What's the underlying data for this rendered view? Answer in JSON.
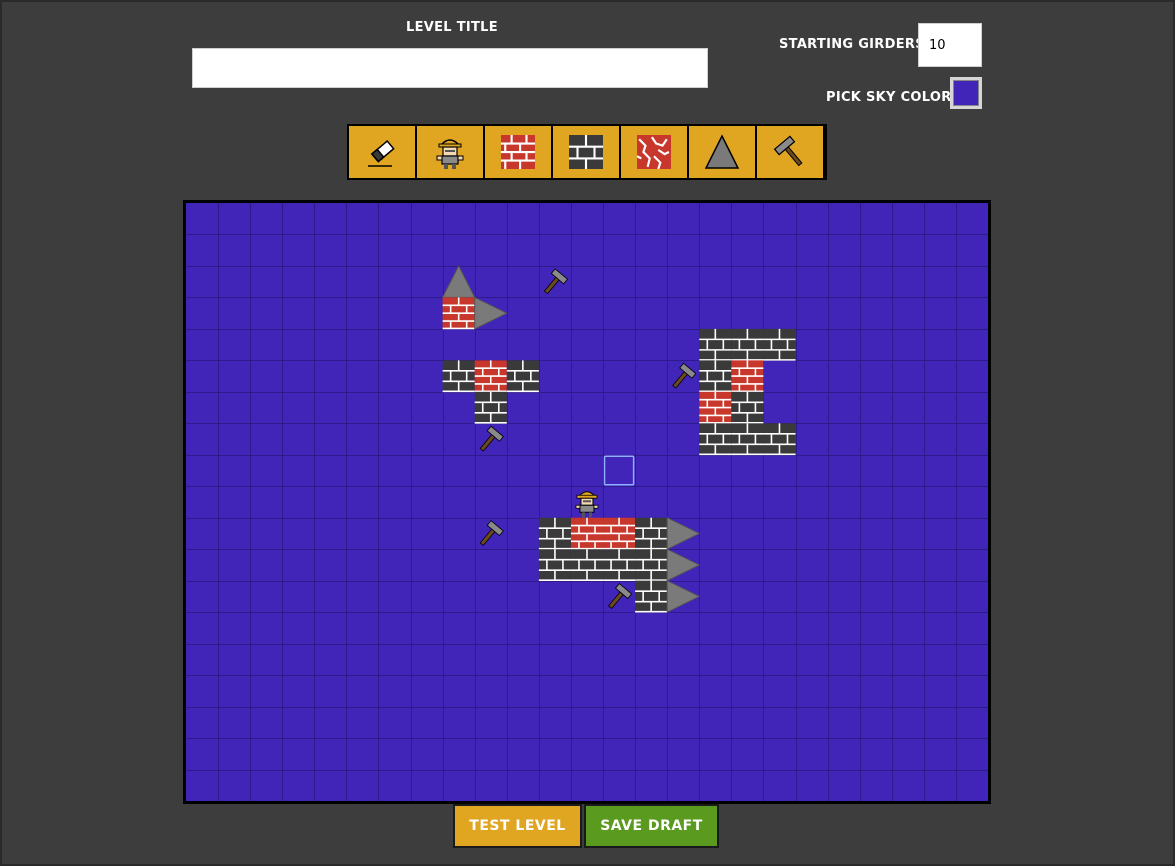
{
  "header": {
    "level_title_label": "LEVEL TITLE",
    "level_title_value": "",
    "starting_girders_label": "STARTING GIRDERS",
    "starting_girders_value": "10",
    "sky_color_label": "PICK SKY COLOR",
    "sky_color": "#4124b8"
  },
  "toolbar": {
    "tools": [
      {
        "name": "eraser-tool",
        "icon": "eraser-icon"
      },
      {
        "name": "worker-tool",
        "icon": "worker-icon"
      },
      {
        "name": "red-brick-tool",
        "icon": "red-brick-icon"
      },
      {
        "name": "dark-brick-tool",
        "icon": "dark-brick-icon"
      },
      {
        "name": "cracked-brick-tool",
        "icon": "cracked-brick-icon"
      },
      {
        "name": "spike-tool",
        "icon": "spike-icon"
      },
      {
        "name": "hammer-tool",
        "icon": "hammer-icon"
      }
    ]
  },
  "board": {
    "columns": 25,
    "rows": 19,
    "colors": {
      "sky": "#4124b8",
      "grid": "#2e1a8a",
      "red_brick": "#c8372c",
      "dark_brick": "#3a3a3a",
      "spike": "#7a7a7a",
      "hammer_head": "#8a8a8a",
      "hammer_handle": "#6b4a1e",
      "cursor": "#8fb0ff"
    },
    "tiles": [
      {
        "type": "spike",
        "col": 8,
        "row": 2,
        "dir": "up"
      },
      {
        "type": "red",
        "col": 8,
        "row": 3
      },
      {
        "type": "spike",
        "col": 9,
        "row": 3,
        "dir": "right"
      },
      {
        "type": "hammer",
        "col": 11,
        "row": 2
      },
      {
        "type": "dark",
        "col": 8,
        "row": 5
      },
      {
        "type": "red",
        "col": 9,
        "row": 5
      },
      {
        "type": "dark",
        "col": 10,
        "row": 5
      },
      {
        "type": "dark",
        "col": 9,
        "row": 6
      },
      {
        "type": "hammer",
        "col": 9,
        "row": 7
      },
      {
        "type": "dark",
        "col": 16,
        "row": 4
      },
      {
        "type": "dark",
        "col": 17,
        "row": 4
      },
      {
        "type": "dark",
        "col": 18,
        "row": 4
      },
      {
        "type": "hammer",
        "col": 15,
        "row": 5
      },
      {
        "type": "dark",
        "col": 16,
        "row": 5
      },
      {
        "type": "red",
        "col": 17,
        "row": 5
      },
      {
        "type": "red",
        "col": 16,
        "row": 6
      },
      {
        "type": "dark",
        "col": 17,
        "row": 6
      },
      {
        "type": "dark",
        "col": 16,
        "row": 7
      },
      {
        "type": "dark",
        "col": 17,
        "row": 7
      },
      {
        "type": "dark",
        "col": 18,
        "row": 7
      },
      {
        "type": "cursor",
        "col": 13,
        "row": 8
      },
      {
        "type": "worker",
        "col": 12,
        "row": 9
      },
      {
        "type": "hammer",
        "col": 9,
        "row": 10
      },
      {
        "type": "dark",
        "col": 11,
        "row": 10
      },
      {
        "type": "red",
        "col": 12,
        "row": 10
      },
      {
        "type": "red",
        "col": 13,
        "row": 10
      },
      {
        "type": "dark",
        "col": 14,
        "row": 10
      },
      {
        "type": "spike",
        "col": 15,
        "row": 10,
        "dir": "right"
      },
      {
        "type": "dark",
        "col": 11,
        "row": 11
      },
      {
        "type": "dark",
        "col": 12,
        "row": 11
      },
      {
        "type": "dark",
        "col": 13,
        "row": 11
      },
      {
        "type": "dark",
        "col": 14,
        "row": 11
      },
      {
        "type": "spike",
        "col": 15,
        "row": 11,
        "dir": "right"
      },
      {
        "type": "hammer",
        "col": 13,
        "row": 12
      },
      {
        "type": "dark",
        "col": 14,
        "row": 12
      },
      {
        "type": "spike",
        "col": 15,
        "row": 12,
        "dir": "right"
      }
    ]
  },
  "actions": {
    "test_level_label": "TEST LEVEL",
    "save_draft_label": "SAVE DRAFT",
    "test_level_color": "#e0a622",
    "save_draft_color": "#5a9a1e"
  }
}
